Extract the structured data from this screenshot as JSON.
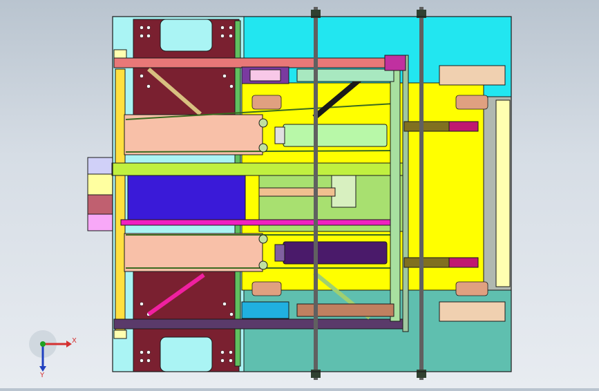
{
  "viewport": {
    "background_top": "#b9c4cf",
    "background_bottom": "#e8ecf1"
  },
  "colors": {
    "frame_outline": "#1a1a1a",
    "cyan_plate": "#22e6f0",
    "light_cyan": "#aaf4f4",
    "teal_plate": "#5fbfaf",
    "maroon_plate": "#7a2030",
    "yellow_plate": "#ffff00",
    "pale_yellow": "#ffffb0",
    "salmon_rail": "#f8c0a8",
    "light_green_cyl": "#b8f8a8",
    "purple_cyl": "#4a1a6a",
    "blue_block": "#3a1ad8",
    "lime_bar": "#c0f040",
    "olive_green": "#a8d870",
    "rose_bar": "#e87878",
    "magenta": "#f020c0",
    "dark_purple_bar": "#5a3a6a",
    "brown_block": "#c08060",
    "shaft": "#606060",
    "sprocket": "#e0a080"
  },
  "triad": {
    "x_label": "X",
    "y_label": "Y",
    "x_color": "#d43030",
    "y_color": "#2040c0",
    "z_color": "#20a020"
  }
}
